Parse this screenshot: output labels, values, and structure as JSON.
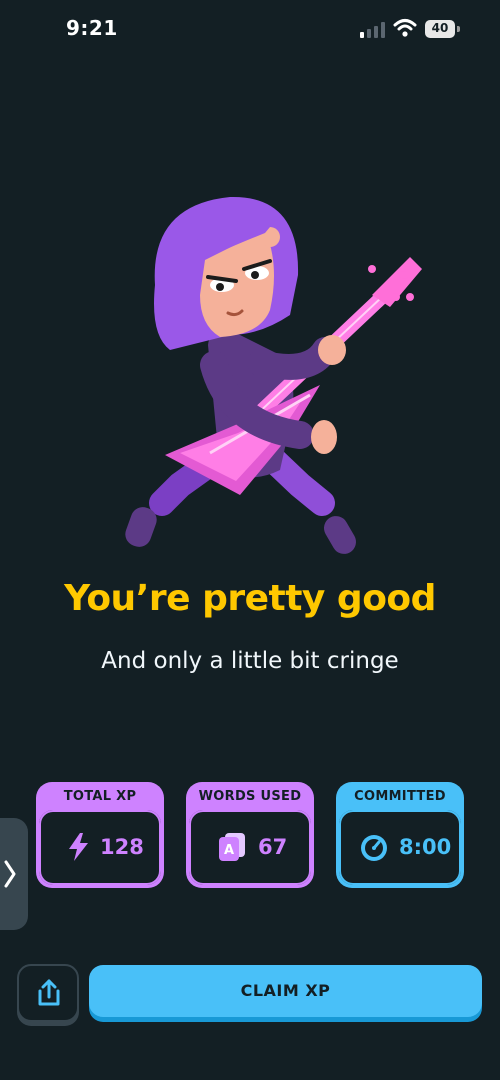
{
  "status_bar": {
    "time": "9:21",
    "battery": "40"
  },
  "result": {
    "headline": "You’re pretty good",
    "subhead": "And only a little bit cringe"
  },
  "stats": [
    {
      "label": "TOTAL XP",
      "value": "128",
      "icon": "lightning-icon",
      "color": "#ce82ff"
    },
    {
      "label": "WORDS USED",
      "value": "67",
      "icon": "letter-cards-icon",
      "glyph": "A",
      "color": "#ce82ff"
    },
    {
      "label": "COMMITTED",
      "value": "8:00",
      "icon": "stopwatch-icon",
      "color": "#49c0f8"
    }
  ],
  "actions": {
    "claim_label": "CLAIM XP",
    "share_icon": "share-icon",
    "side_tab_icon": "chevron-right-icon"
  },
  "colors": {
    "background": "#131f24",
    "headline": "#ffc800",
    "accent_purple": "#ce82ff",
    "accent_blue": "#49c0f8"
  }
}
